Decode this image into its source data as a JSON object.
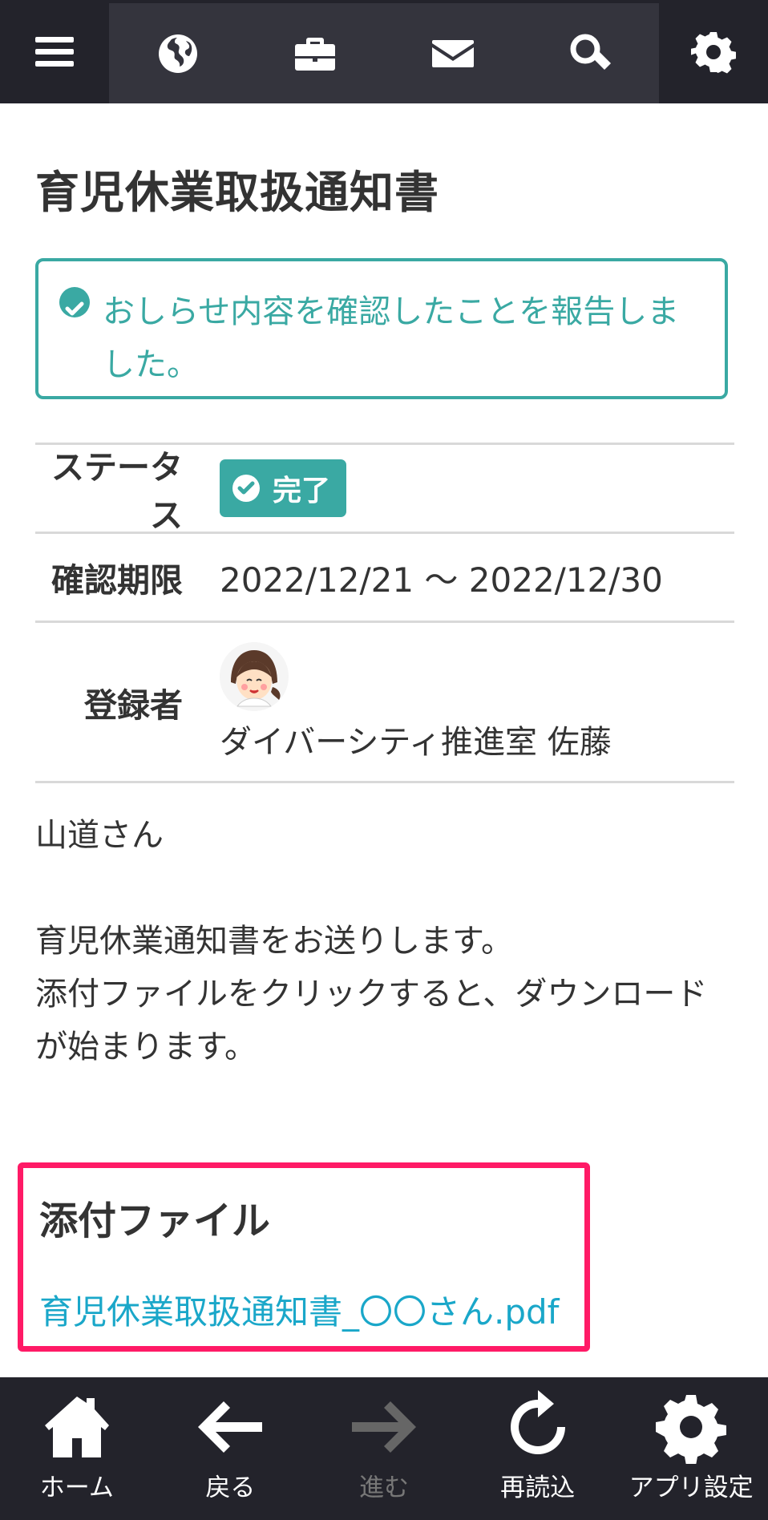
{
  "top_nav": {
    "icons": [
      "menu-icon",
      "globe-icon",
      "briefcase-icon",
      "mail-icon",
      "search-icon",
      "gear-icon"
    ]
  },
  "page": {
    "title": "育児休業取扱通知書"
  },
  "alert": {
    "message": "おしらせ内容を確認したことを報告しました。",
    "color": "#3aa9a3"
  },
  "info": {
    "status_label": "ステータス",
    "status_value": "完了",
    "deadline_label": "確認期限",
    "deadline_value": "2022/12/21 〜 2022/12/30",
    "author_label": "登録者",
    "author_name": "ダイバーシティ推進室 佐藤"
  },
  "body": {
    "line1": "山道さん",
    "line2": "育児休業通知書をお送りします。",
    "line3": "添付ファイルをクリックすると、ダウンロードが始まります。"
  },
  "attachments": {
    "title": "添付ファイル",
    "file_name": "育児休業取扱通知書_〇〇さん.pdf",
    "highlight_color": "#ff1a66",
    "link_color": "#1aa7c9"
  },
  "bottom_nav": {
    "home": "ホーム",
    "back": "戻る",
    "forward": "進む",
    "reload": "再読込",
    "app_settings": "アプリ設定"
  }
}
